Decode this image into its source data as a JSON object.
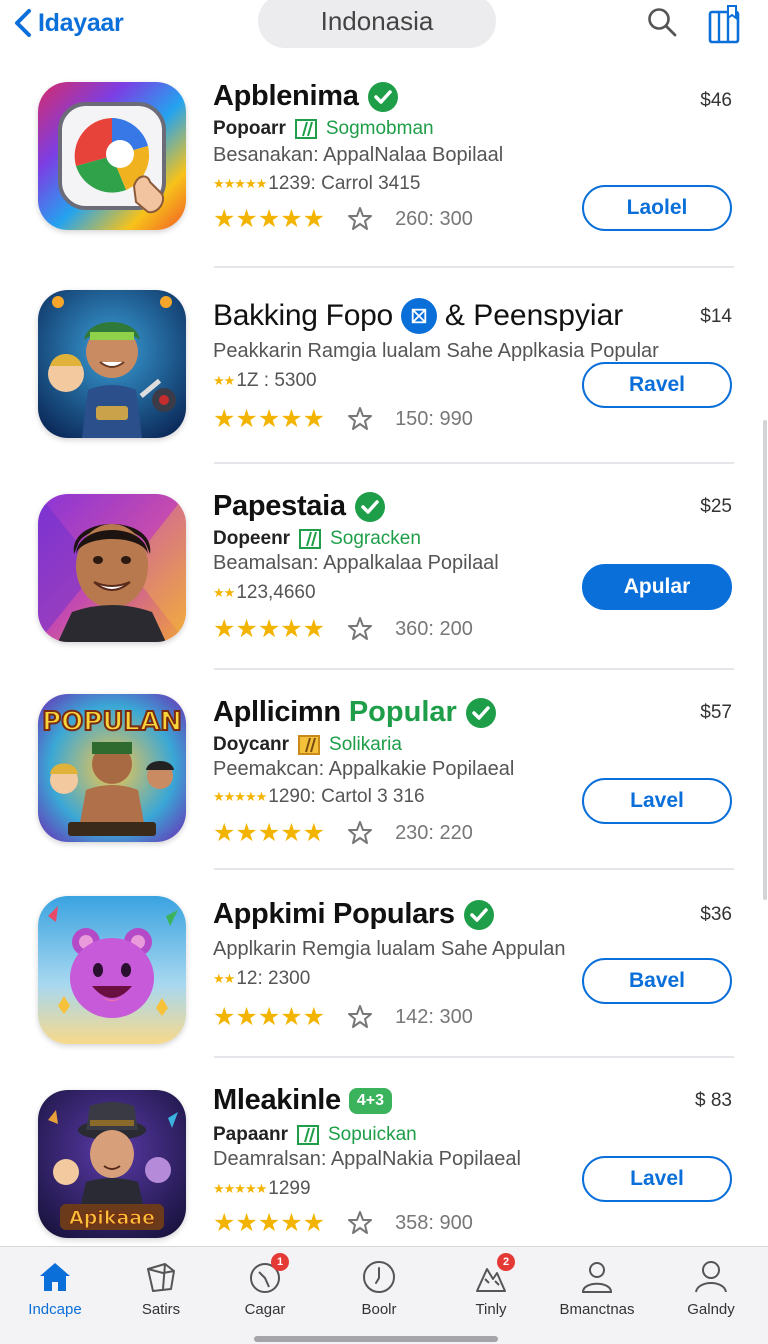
{
  "header": {
    "back_label": "Idayaar",
    "country": "Indonasia"
  },
  "apps": [
    {
      "title": "Apblenima",
      "title_extra": "",
      "price": "$46",
      "developer": "Popoarr",
      "category": "Sogmobman",
      "description": "Besanakan: AppalNalaa Bopilaal",
      "stats": "1239: Carrol 3415",
      "rating_count": "260: 300",
      "button_label": "Laolel",
      "button_style": "outline",
      "badge": "verified",
      "icon": "color-wheel-icon"
    },
    {
      "title": "Bakking Fopo",
      "title_extra": "& Peenspyiar",
      "price": "$14",
      "developer": "",
      "category": "",
      "description": "Peakkarin Ramgia lualam Sahe Applkasia Popular",
      "stats": "1Z : 5300",
      "rating_count": "150: 990",
      "button_label": "Ravel",
      "button_style": "outline",
      "badge": "blue",
      "icon": "gamer-character-icon"
    },
    {
      "title": "Papestaia",
      "title_extra": "",
      "price": "$25",
      "developer": "Dopeenr",
      "category": "Sogracken",
      "description": "Beamalsan: Appalkalaa Popilaal",
      "stats": "123,4660",
      "rating_count": "360: 200",
      "button_label": "Apular",
      "button_style": "filled",
      "badge": "verified",
      "icon": "smiling-man-icon"
    },
    {
      "title": "Apllicimn",
      "title_extra": "Popular",
      "price": "$57",
      "developer": "Doycanr",
      "category": "Solikaria",
      "description": "Peemakcan: Appalkakie Popilaeal",
      "stats": "1290: Cartol 3 316",
      "rating_count": "230: 220",
      "button_label": "Lavel",
      "button_style": "outline",
      "badge": "verified",
      "icon": "popular-game-icon",
      "icon_text": "POPULAN"
    },
    {
      "title": "Appkimi Populars",
      "title_extra": "",
      "price": "$36",
      "developer": "",
      "category": "",
      "description": "Applkarin Remgia lualam Sahe Appulan",
      "stats": "12: 2300",
      "rating_count": "142: 300",
      "button_label": "Bavel",
      "button_style": "outline",
      "badge": "verified",
      "icon": "purple-bear-icon"
    },
    {
      "title": "Mleakinle",
      "title_extra": "",
      "price": "$ 83",
      "developer": "Papaanr",
      "category": "Sopuickan",
      "description": "Deamralsan: AppalNakia Popilaeal",
      "stats": "1299",
      "rating_count": "358: 900",
      "button_label": "Lavel",
      "button_style": "outline",
      "badge": "4+3",
      "icon": "detective-character-icon",
      "icon_text": "Apikaae"
    }
  ],
  "tabs": [
    {
      "label": "Indcape",
      "icon": "home-icon",
      "active": true
    },
    {
      "label": "Satirs",
      "icon": "box-icon"
    },
    {
      "label": "Cagar",
      "icon": "compass-icon",
      "notification": "1"
    },
    {
      "label": "Boolr",
      "icon": "clock-icon"
    },
    {
      "label": "Tinly",
      "icon": "mountain-icon",
      "notification": "2"
    },
    {
      "label": "Bmanctnas",
      "icon": "person-icon"
    },
    {
      "label": "Galndy",
      "icon": "profile-icon"
    }
  ],
  "colors": {
    "accent": "#0a6fd9",
    "green": "#1e9e48",
    "star": "#f3b400",
    "badge_red": "#e53935"
  }
}
